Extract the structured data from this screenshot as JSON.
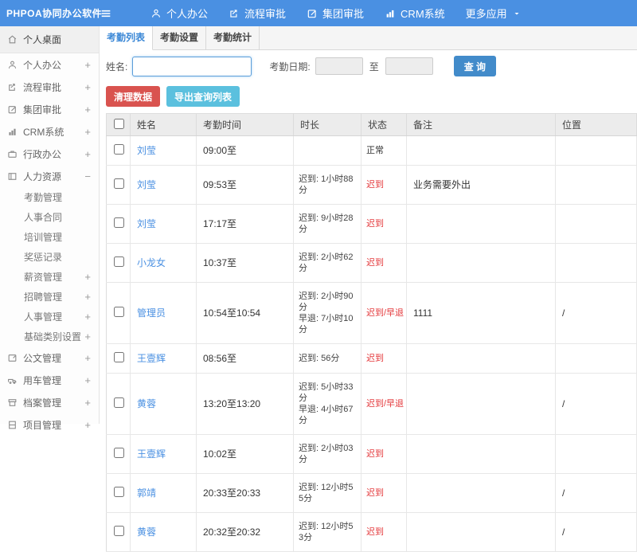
{
  "app": {
    "logo": "PHPOA协同办公软件"
  },
  "topnav": {
    "items": [
      {
        "label": "个人办公",
        "icon": "user-icon"
      },
      {
        "label": "流程审批",
        "icon": "flow-icon"
      },
      {
        "label": "集团审批",
        "icon": "edit-icon"
      },
      {
        "label": "CRM系统",
        "icon": "chart-icon"
      },
      {
        "label": "更多应用",
        "icon": "caret-down-icon"
      }
    ]
  },
  "sidebar": {
    "items": [
      {
        "label": "个人桌面",
        "icon": "home-icon",
        "expand": ""
      },
      {
        "label": "个人办公",
        "icon": "user-icon",
        "expand": "+"
      },
      {
        "label": "流程审批",
        "icon": "flow-icon",
        "expand": "+"
      },
      {
        "label": "集团审批",
        "icon": "edit-icon",
        "expand": "+"
      },
      {
        "label": "CRM系统",
        "icon": "chart-icon",
        "expand": "+"
      },
      {
        "label": "行政办公",
        "icon": "briefcase-icon",
        "expand": "+"
      },
      {
        "label": "人力资源",
        "icon": "book-icon",
        "expand": "−"
      },
      {
        "label": "公文管理",
        "icon": "document-icon",
        "expand": "+"
      },
      {
        "label": "用车管理",
        "icon": "car-icon",
        "expand": "+"
      },
      {
        "label": "档案管理",
        "icon": "archive-icon",
        "expand": "+"
      },
      {
        "label": "项目管理",
        "icon": "project-icon",
        "expand": "+"
      }
    ],
    "hr_children": [
      {
        "label": "考勤管理",
        "expand": ""
      },
      {
        "label": "人事合同",
        "expand": ""
      },
      {
        "label": "培训管理",
        "expand": ""
      },
      {
        "label": "奖惩记录",
        "expand": ""
      },
      {
        "label": "薪资管理",
        "expand": "+"
      },
      {
        "label": "招聘管理",
        "expand": "+"
      },
      {
        "label": "人事管理",
        "expand": "+"
      },
      {
        "label": "基础类别设置",
        "expand": "+"
      }
    ]
  },
  "tabs": [
    {
      "label": "考勤列表",
      "active": true
    },
    {
      "label": "考勤设置",
      "active": false
    },
    {
      "label": "考勤统计",
      "active": false
    }
  ],
  "filter": {
    "name_label": "姓名:",
    "name_value": "",
    "date_label": "考勤日期:",
    "to_label": "至",
    "date_from": "",
    "date_to": "",
    "query_button": "查 询"
  },
  "actions": {
    "clean_button": "清理数据",
    "export_button": "导出查询列表"
  },
  "table": {
    "columns": [
      "姓名",
      "考勤时间",
      "时长",
      "状态",
      "备注",
      "位置"
    ],
    "rows": [
      {
        "name": "刘莹",
        "time": "09:00至",
        "duration": "",
        "duration2": "",
        "status": "正常",
        "remark": "",
        "location": ""
      },
      {
        "name": "刘莹",
        "time": "09:53至",
        "duration": "迟到: 1小时88分",
        "duration2": "",
        "status": "迟到",
        "remark": "业务需要外出",
        "location": ""
      },
      {
        "name": "刘莹",
        "time": "17:17至",
        "duration": "迟到: 9小时28分",
        "duration2": "",
        "status": "迟到",
        "remark": "",
        "location": ""
      },
      {
        "name": "小龙女",
        "time": "10:37至",
        "duration": "迟到: 2小时62分",
        "duration2": "",
        "status": "迟到",
        "remark": "",
        "location": ""
      },
      {
        "name": "管理员",
        "time": "10:54至10:54",
        "duration": "迟到: 2小时90分",
        "duration2": "早退: 7小时10分",
        "status": "迟到/早退",
        "remark": "1111",
        "location": "/"
      },
      {
        "name": "王壹辉",
        "time": "08:56至",
        "duration": "迟到: 56分",
        "duration2": "",
        "status": "迟到",
        "remark": "",
        "location": ""
      },
      {
        "name": "黄蓉",
        "time": "13:20至13:20",
        "duration": "迟到: 5小时33分",
        "duration2": "早退: 4小时67分",
        "status": "迟到/早退",
        "remark": "",
        "location": "/"
      },
      {
        "name": "王壹辉",
        "time": "10:02至",
        "duration": "迟到: 2小时03分",
        "duration2": "",
        "status": "迟到",
        "remark": "",
        "location": ""
      },
      {
        "name": "郭靖",
        "time": "20:33至20:33",
        "duration": "迟到: 12小时55分",
        "duration2": "",
        "status": "迟到",
        "remark": "",
        "location": "/"
      },
      {
        "name": "黄蓉",
        "time": "20:32至20:32",
        "duration": "迟到: 12小时53分",
        "duration2": "",
        "status": "迟到",
        "remark": "",
        "location": "/"
      }
    ]
  },
  "colors": {
    "topbar_blue": "#4a90e2",
    "link_blue": "#4a90e2",
    "query_blue": "#428bca",
    "danger_red": "#d9534f",
    "status_red": "#e4393c",
    "info_teal": "#5bc0de",
    "table_header_gray": "#ececec"
  }
}
